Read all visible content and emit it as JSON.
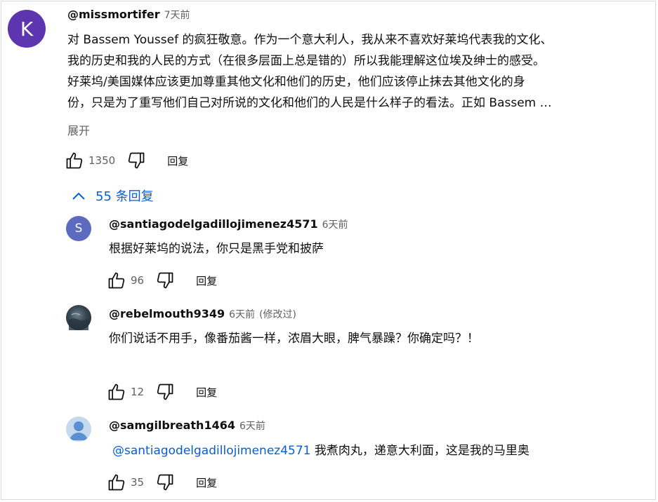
{
  "top_comment": {
    "avatar_letter": "K",
    "author": "@missmortifer",
    "time": "7天前",
    "lines": [
      "对 Bassem Youssef 的疯狂敬意。作为一个意大利人，我从来不喜欢好莱坞代表我的文化、",
      "我的历史和我的人民的方式（在很多层面上总是错的）所以我能理解这位埃及绅士的感受。",
      "好莱坞/美国媒体应该更加尊重其他文化和他们的历史，他们应该停止抹去其他文化的身",
      "份，只是为了重写他们自己对所说的文化和他们的人民是什么样子的看法。正如 Bassem …"
    ],
    "expand_label": "展开",
    "likes": "1350",
    "reply_label": "回复"
  },
  "replies_toggle": {
    "count_label": "55 条回复"
  },
  "replies": [
    {
      "avatar_letter": "S",
      "author": "@santiagodelgadillojimenez4571",
      "time": "6天前",
      "text": "根据好莱坞的说法，你只是黑手党和披萨",
      "likes": "96",
      "reply_label": "回复"
    },
    {
      "author": "@rebelmouth9349",
      "time": "6天前",
      "edited": "(修改过)",
      "text": "你们说话不用手，像番茄酱一样，浓眉大眼，脾气暴躁？你确定吗？！",
      "likes": "12",
      "reply_label": "回复"
    },
    {
      "author": "@samgilbreath1464",
      "time": "6天前",
      "mention": "@santiagodelgadillojimenez4571",
      "text": " 我煮肉丸，递意大利面，这是我的马里奥",
      "likes": "35",
      "reply_label": "回复"
    }
  ],
  "colors": {
    "accent": "#065fd4",
    "avatar_k": "#5e35b1",
    "avatar_s": "#5c6bc0",
    "avatar_default": "#c5d8ee"
  },
  "icons": [
    "like-icon",
    "dislike-icon",
    "chevron-up-icon",
    "default-avatar-icon"
  ]
}
